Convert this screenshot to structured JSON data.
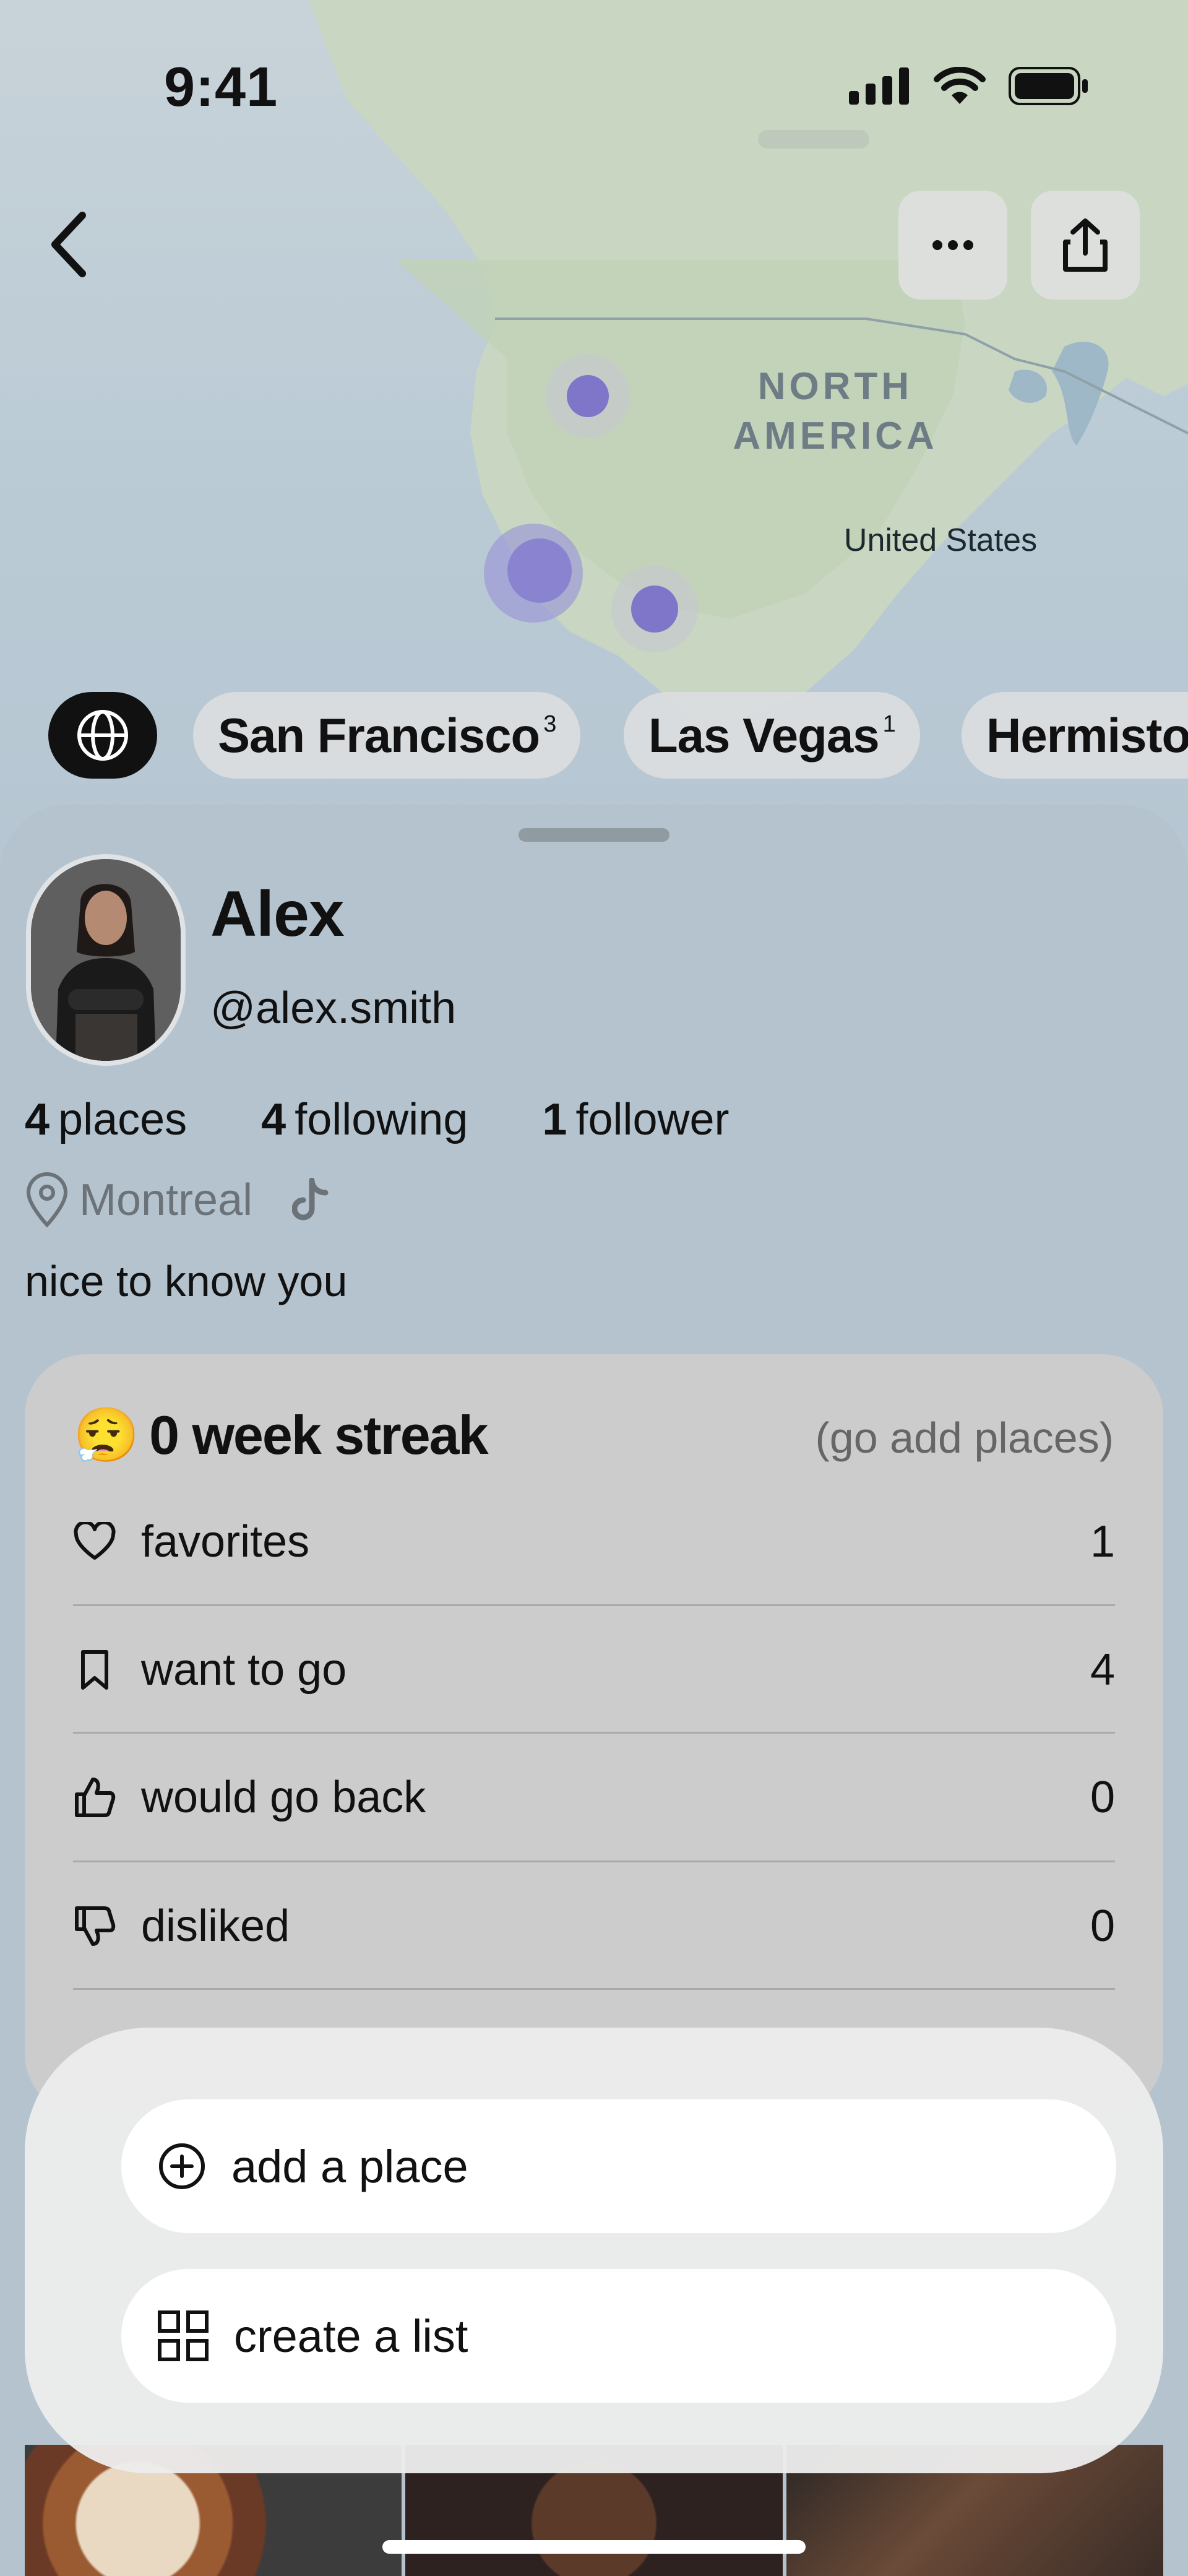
{
  "status_bar": {
    "time": "9:41"
  },
  "map": {
    "labels": {
      "continent_line1": "NORTH",
      "continent_line2": "AMERICA",
      "country": "United States"
    }
  },
  "chips": [
    {
      "label": "San Francisco",
      "count": "3"
    },
    {
      "label": "Las Vegas",
      "count": "1"
    },
    {
      "label": "Hermisto"
    }
  ],
  "profile": {
    "name": "Alex",
    "handle": "@alex.smith",
    "stats": {
      "places": {
        "value": "4",
        "label": "places"
      },
      "following": {
        "value": "4",
        "label": "following"
      },
      "followers": {
        "value": "1",
        "label": "follower"
      }
    },
    "location": "Montreal",
    "bio": "nice to know you"
  },
  "streak": {
    "emoji": "😮‍💨",
    "title": "0 week streak",
    "hint": "(go add places)"
  },
  "lists": [
    {
      "label": "favorites",
      "count": "1",
      "icon": "heart-icon"
    },
    {
      "label": "want to go",
      "count": "4",
      "icon": "bookmark-icon"
    },
    {
      "label": "would go back",
      "count": "0",
      "icon": "thumbs-up-icon"
    },
    {
      "label": "disliked",
      "count": "0",
      "icon": "thumbs-down-icon"
    }
  ],
  "actions": {
    "add_place": "add a place",
    "create_list": "create a list"
  },
  "colors": {
    "accent_dot": "#7f76c9",
    "card": "#cccccc",
    "sheet": "#b4c3ce"
  }
}
